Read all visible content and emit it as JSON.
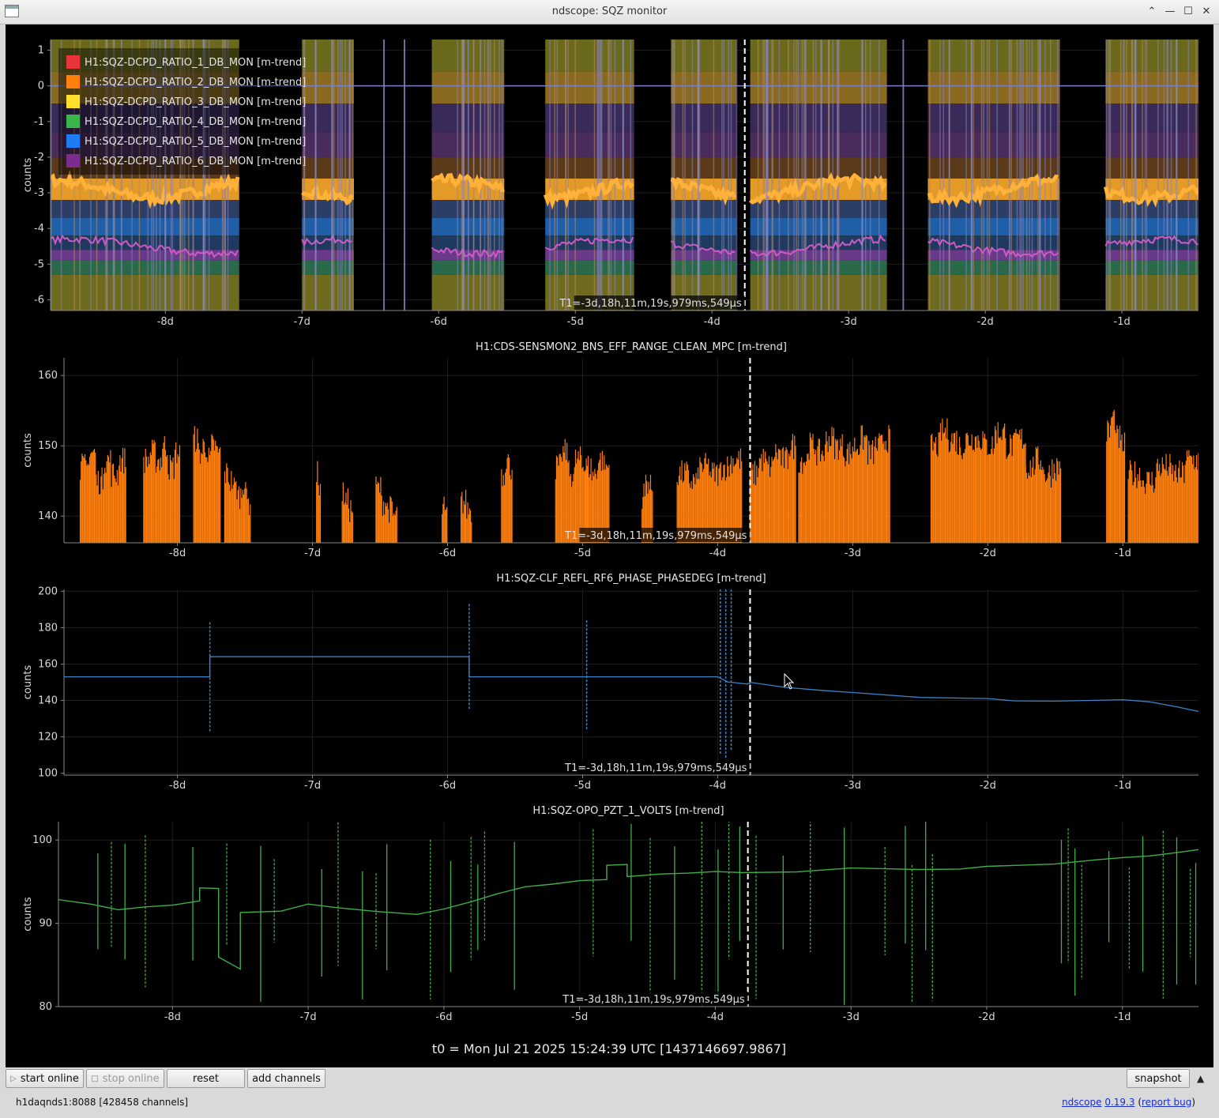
{
  "window": {
    "title": "ndscope: SQZ monitor"
  },
  "legend": [
    {
      "label": "H1:SQZ-DCPD_RATIO_1_DB_MON [m-trend]",
      "color": "#e8343a"
    },
    {
      "label": "H1:SQZ-DCPD_RATIO_2_DB_MON [m-trend]",
      "color": "#ff7f0e"
    },
    {
      "label": "H1:SQZ-DCPD_RATIO_3_DB_MON [m-trend]",
      "color": "#ffdf2c"
    },
    {
      "label": "H1:SQZ-DCPD_RATIO_4_DB_MON [m-trend]",
      "color": "#3ab54a"
    },
    {
      "label": "H1:SQZ-DCPD_RATIO_5_DB_MON [m-trend]",
      "color": "#1f7bf2"
    },
    {
      "label": "H1:SQZ-DCPD_RATIO_6_DB_MON [m-trend]",
      "color": "#7b2d8e"
    }
  ],
  "cursor_label": "T1=-3d,18h,11m,19s,979ms,549µs",
  "cursor_x": -3.76,
  "xticks": [
    "-8d",
    "-7d",
    "-6d",
    "-5d",
    "-4d",
    "-3d",
    "-2d",
    "-1d"
  ],
  "xtick_values": [
    -8,
    -7,
    -6,
    -5,
    -4,
    -3,
    -2,
    -1
  ],
  "xrange": [
    -8.84,
    -0.44
  ],
  "ylabel": "counts",
  "chart_data": [
    {
      "type": "area",
      "title": "",
      "ylabel": "counts",
      "ylim": [
        -6.3,
        1.3
      ],
      "yticks": [
        "1",
        "0",
        "-1",
        "-2",
        "-3",
        "-4",
        "-5",
        "-6"
      ],
      "ytick_values": [
        1,
        0,
        -1,
        -2,
        -3,
        -4,
        -5,
        -6
      ],
      "bands": [
        [
          -8.84,
          -7.46
        ],
        [
          -7.0,
          -6.62
        ],
        [
          -6.05,
          -5.52
        ],
        [
          -5.22,
          -4.57
        ],
        [
          -4.3,
          -3.82
        ],
        [
          -3.72,
          -2.72
        ],
        [
          -2.42,
          -1.46
        ],
        [
          -1.12,
          -0.44
        ]
      ],
      "band_vlines": [
        -8.0,
        -7.72,
        -6.9,
        -6.78,
        -6.4,
        -6.25,
        -5.82,
        -4.65,
        -4.1,
        -3.6,
        -3.2,
        -2.9,
        -2.6,
        -2.1,
        -1.6,
        -0.9,
        -0.6
      ],
      "series": [
        {
          "name": "H1:SQZ-DCPD_RATIO_1_DB_MON [m-trend]",
          "level": -4.3
        },
        {
          "name": "H1:SQZ-DCPD_RATIO_2_DB_MON [m-trend]",
          "level": -2.4
        },
        {
          "name": "H1:SQZ-DCPD_RATIO_3_DB_MON [m-trend]",
          "level": -2.9
        },
        {
          "name": "H1:SQZ-DCPD_RATIO_4_DB_MON [m-trend]",
          "level": -4.6
        },
        {
          "name": "H1:SQZ-DCPD_RATIO_5_DB_MON [m-trend]",
          "level": -4.0
        },
        {
          "name": "H1:SQZ-DCPD_RATIO_6_DB_MON [m-trend]",
          "level": -1.5
        }
      ],
      "flat_value": 0
    },
    {
      "type": "bar",
      "title": "H1:CDS-SENSMON2_BNS_EFF_RANGE_CLEAN_MPC [m-trend]",
      "ylabel": "counts",
      "ylim": [
        136.2,
        162.5
      ],
      "yticks": [
        "160",
        "150",
        "140"
      ],
      "ytick_values": [
        160,
        150,
        140
      ],
      "color": "#ff7f0e",
      "segments": [
        {
          "x": [
            -8.72,
            -8.38
          ],
          "y": [
            147,
            149,
            145,
            148,
            146,
            148
          ]
        },
        {
          "x": [
            -8.25,
            -7.98
          ],
          "y": [
            148,
            149,
            148,
            150,
            147,
            149
          ]
        },
        {
          "x": [
            -7.88,
            -7.68
          ],
          "y": [
            151,
            149,
            150,
            148,
            150,
            149
          ]
        },
        {
          "x": [
            -7.65,
            -7.46
          ],
          "y": [
            146,
            145,
            144,
            143,
            145,
            142
          ]
        },
        {
          "x": [
            -6.97,
            -6.94
          ],
          "y": [
            146,
            144
          ]
        },
        {
          "x": [
            -6.78,
            -6.7
          ],
          "y": [
            143,
            142,
            141
          ]
        },
        {
          "x": [
            -6.53,
            -6.37
          ],
          "y": [
            144,
            142,
            141,
            140
          ]
        },
        {
          "x": [
            -6.04,
            -6.0
          ],
          "y": [
            141,
            140
          ]
        },
        {
          "x": [
            -5.9,
            -5.82
          ],
          "y": [
            142,
            141
          ]
        },
        {
          "x": [
            -5.6,
            -5.52
          ],
          "y": [
            146,
            148,
            147
          ]
        },
        {
          "x": [
            -5.2,
            -4.96
          ],
          "y": [
            147,
            149,
            146,
            148,
            147
          ]
        },
        {
          "x": [
            -4.98,
            -4.8
          ],
          "y": [
            147,
            146,
            148,
            147
          ]
        },
        {
          "x": [
            -4.56,
            -4.48
          ],
          "y": [
            143,
            145,
            144
          ]
        },
        {
          "x": [
            -4.3,
            -3.82
          ],
          "y": [
            146,
            145,
            147,
            146,
            147,
            148
          ]
        },
        {
          "x": [
            -3.76,
            -3.42
          ],
          "y": [
            146,
            148,
            147,
            149,
            148,
            150
          ]
        },
        {
          "x": [
            -3.4,
            -3.0
          ],
          "y": [
            148,
            150,
            149,
            151,
            150,
            149
          ]
        },
        {
          "x": [
            -3.0,
            -2.72
          ],
          "y": [
            150,
            151,
            149,
            150,
            151
          ]
        },
        {
          "x": [
            -2.42,
            -2.1
          ],
          "y": [
            150,
            152,
            151,
            150,
            151
          ]
        },
        {
          "x": [
            -2.1,
            -1.72
          ],
          "y": [
            151,
            150,
            152,
            150,
            151
          ]
        },
        {
          "x": [
            -1.72,
            -1.46
          ],
          "y": [
            147,
            148,
            146,
            147
          ]
        },
        {
          "x": [
            -1.12,
            -0.98
          ],
          "y": [
            152,
            154,
            151,
            150
          ]
        },
        {
          "x": [
            -0.96,
            -0.44
          ],
          "y": [
            146,
            145,
            147,
            146,
            148
          ]
        }
      ]
    },
    {
      "type": "line",
      "title": "H1:SQZ-CLF_REFL_RF6_PHASE_PHASEDEG [m-trend]",
      "ylabel": "counts",
      "ylim": [
        99,
        201
      ],
      "yticks": [
        "200",
        "180",
        "160",
        "140",
        "120",
        "100"
      ],
      "ytick_values": [
        200,
        180,
        160,
        140,
        120,
        100
      ],
      "color": "#3a83c9",
      "x": [
        -8.84,
        -7.76,
        -7.76,
        -5.84,
        -5.84,
        -4.0,
        -3.92,
        -3.9,
        -3.78,
        -3.76,
        -3.5,
        -3.2,
        -3.0,
        -2.5,
        -2.0,
        -1.8,
        -1.5,
        -1.0,
        -0.8,
        -0.6,
        -0.44
      ],
      "y": [
        153,
        153,
        164,
        164,
        153,
        153,
        150,
        150,
        149,
        150,
        147,
        145,
        144,
        142,
        141,
        140,
        140,
        140,
        139,
        136,
        134
      ],
      "spikes": [
        {
          "x": -7.76,
          "lo": 123,
          "hi": 183
        },
        {
          "x": -5.84,
          "lo": 135,
          "hi": 193
        },
        {
          "x": -4.97,
          "lo": 124,
          "hi": 184
        },
        {
          "x": -3.98,
          "lo": 110,
          "hi": 201
        },
        {
          "x": -3.94,
          "lo": 108,
          "hi": 201
        },
        {
          "x": -3.9,
          "lo": 112,
          "hi": 201
        },
        {
          "x": -3.76,
          "lo": 145,
          "hi": 180
        }
      ]
    },
    {
      "type": "line",
      "title": "H1:SQZ-OPO_PZT_1_VOLTS [m-trend]",
      "ylabel": "counts",
      "ylim": [
        80,
        102.2
      ],
      "yticks": [
        "100",
        "90",
        "80"
      ],
      "ytick_values": [
        100,
        90,
        80
      ],
      "color": "#3fae49",
      "x": [
        -8.84,
        -8.6,
        -8.4,
        -8.2,
        -8.0,
        -7.8,
        -7.8,
        -7.66,
        -7.66,
        -7.5,
        -7.5,
        -7.2,
        -7.0,
        -6.8,
        -6.5,
        -6.2,
        -6.0,
        -5.8,
        -5.6,
        -5.4,
        -5.2,
        -5.0,
        -4.8,
        -4.8,
        -4.65,
        -4.65,
        -4.4,
        -4.2,
        -4.0,
        -3.8,
        -3.4,
        -3.0,
        -2.5,
        -2.2,
        -2.0,
        -1.5,
        -1.2,
        -1.0,
        -0.8,
        -0.6,
        -0.44
      ],
      "y": [
        92.8,
        92.2,
        91.5,
        92.0,
        92.3,
        92.6,
        94.2,
        94.2,
        86.0,
        84.6,
        91.2,
        91.5,
        92.2,
        92.0,
        91.4,
        91.2,
        91.8,
        92.6,
        93.5,
        94.3,
        94.7,
        95.0,
        95.2,
        97.0,
        97.0,
        95.5,
        95.8,
        96.0,
        96.1,
        96.2,
        96.3,
        96.5,
        96.4,
        96.6,
        96.7,
        97.0,
        97.5,
        97.8,
        98.2,
        98.5,
        98.8
      ],
      "spikes": [
        -8.55,
        -8.45,
        -8.35,
        -8.2,
        -7.85,
        -7.6,
        -7.35,
        -7.25,
        -6.9,
        -6.78,
        -6.6,
        -6.5,
        -6.42,
        -6.1,
        -5.95,
        -5.8,
        -5.75,
        -5.7,
        -5.48,
        -4.9,
        -4.62,
        -4.48,
        -4.3,
        -4.1,
        -3.98,
        -3.9,
        -3.82,
        -3.7,
        -3.5,
        -3.3,
        -3.05,
        -2.75,
        -2.6,
        -2.55,
        -2.45,
        -2.4,
        -1.45,
        -1.4,
        -1.35,
        -1.3,
        -1.1,
        -0.95,
        -0.85,
        -0.7,
        -0.6,
        -0.5,
        -0.46
      ]
    }
  ],
  "t0_label": "t0 = Mon Jul 21 2025 15:24:39 UTC [1437146697.9867]",
  "buttons": {
    "start_online": "start online",
    "stop_online": "stop online",
    "reset": "reset",
    "add_channels": "add channels",
    "snapshot": "snapshot"
  },
  "status": {
    "server": "h1daqnds1:8088  [428458 channels]",
    "app_name": "ndscope",
    "version": "0.19.3",
    "report_bug": "report bug"
  }
}
